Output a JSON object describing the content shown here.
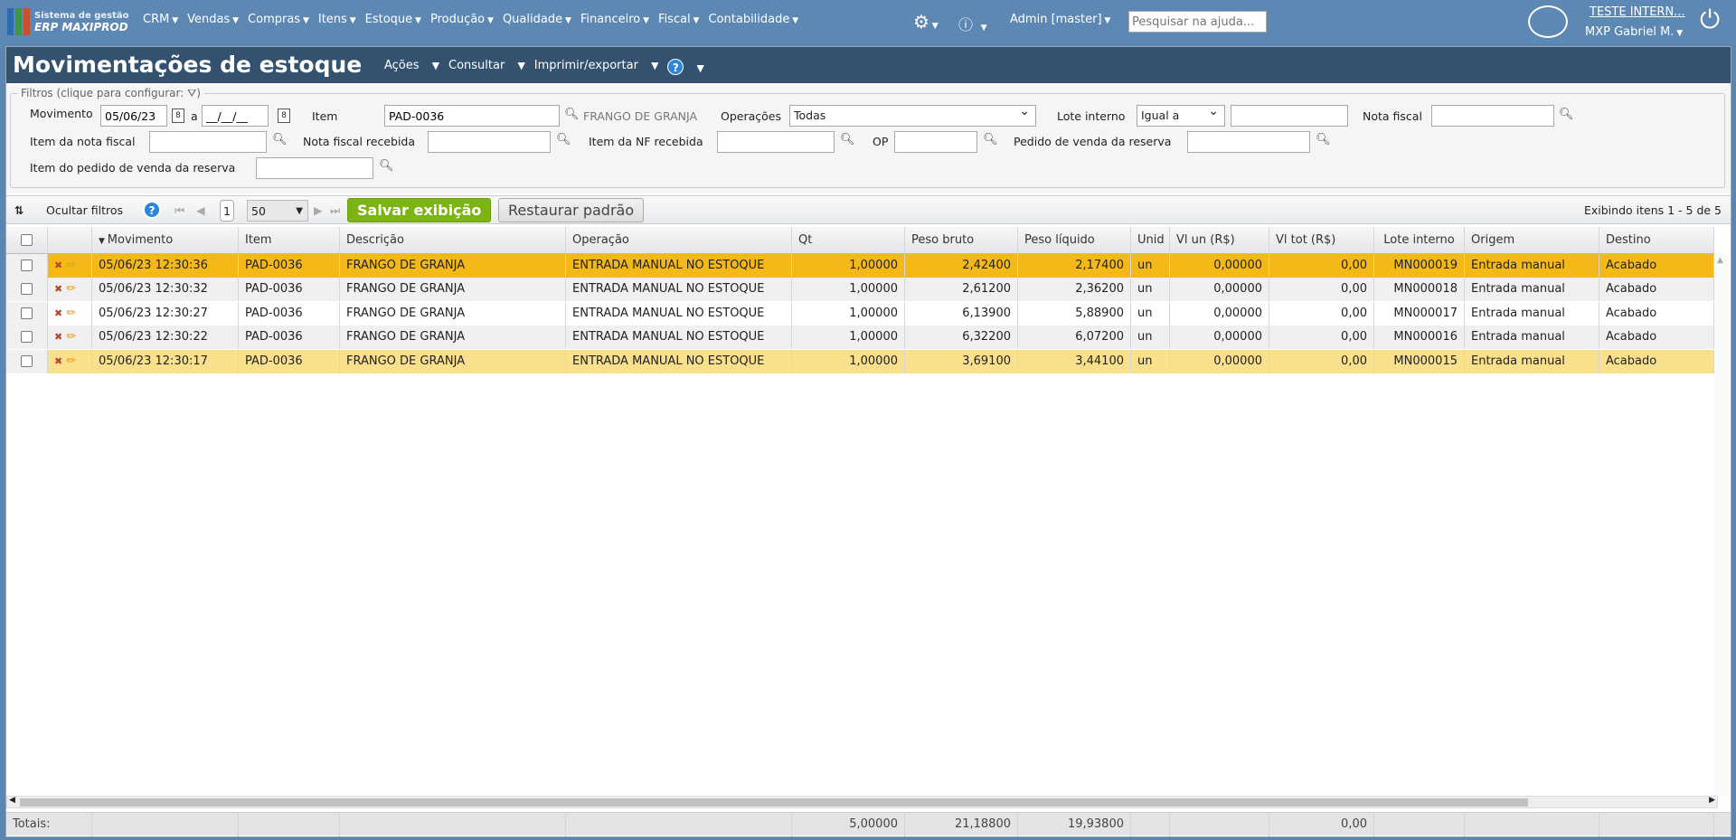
{
  "topbar": {
    "logo_line1": "Sistema de gestão",
    "logo_line2": "ERP MAXIPROD",
    "menu": [
      "CRM",
      "Vendas",
      "Compras",
      "Itens",
      "Estoque",
      "Produção",
      "Qualidade",
      "Financeiro",
      "Fiscal",
      "Contabilidade"
    ],
    "admin": "Admin [master]",
    "help_placeholder": "Pesquisar na ajuda...",
    "company": "TESTE INTERN...",
    "user": "MXP Gabriel M."
  },
  "page": {
    "title": "Movimentações de estoque",
    "menu": [
      "Ações",
      "Consultar",
      "Imprimir/exportar"
    ]
  },
  "filters": {
    "legend": "Filtros (clique para configurar:",
    "movimento_label": "Movimento",
    "movimento_from": "05/06/23",
    "a_label": "a",
    "movimento_to": "__/__/__",
    "item_label": "Item",
    "item_value": "PAD-0036",
    "item_desc": "FRANGO DE GRANJA",
    "operacoes_label": "Operações",
    "operacoes_value": "Todas",
    "lote_label": "Lote interno",
    "lote_op": "Igual a",
    "nota_label": "Nota fiscal",
    "item_nota_label": "Item da nota fiscal",
    "nf_recebida_label": "Nota fiscal recebida",
    "item_nf_recebida_label": "Item da NF recebida",
    "op_label": "OP",
    "pedido_label": "Pedido de venda da reserva",
    "item_pedido_label": "Item do pedido de venda da reserva"
  },
  "toolbar": {
    "hide_filters": "Ocultar filtros",
    "page": "1",
    "page_size": "50",
    "save": "Salvar exibição",
    "restore": "Restaurar padrão",
    "showing": "Exibindo itens 1 - 5 de 5"
  },
  "grid": {
    "columns": [
      "",
      "",
      "Movimento",
      "Item",
      "Descrição",
      "Operação",
      "Qt",
      "Peso bruto",
      "Peso líquido",
      "Unid",
      "Vl un (R$)",
      "Vl tot (R$)",
      "Lote interno",
      "Origem",
      "Destino"
    ],
    "rows": [
      [
        "05/06/23 12:30:36",
        "PAD-0036",
        "FRANGO DE GRANJA",
        "ENTRADA MANUAL NO ESTOQUE",
        "1,00000",
        "2,42400",
        "2,17400",
        "un",
        "0,00000",
        "0,00",
        "MN000019",
        "Entrada manual",
        "Acabado"
      ],
      [
        "05/06/23 12:30:32",
        "PAD-0036",
        "FRANGO DE GRANJA",
        "ENTRADA MANUAL NO ESTOQUE",
        "1,00000",
        "2,61200",
        "2,36200",
        "un",
        "0,00000",
        "0,00",
        "MN000018",
        "Entrada manual",
        "Acabado"
      ],
      [
        "05/06/23 12:30:27",
        "PAD-0036",
        "FRANGO DE GRANJA",
        "ENTRADA MANUAL NO ESTOQUE",
        "1,00000",
        "6,13900",
        "5,88900",
        "un",
        "0,00000",
        "0,00",
        "MN000017",
        "Entrada manual",
        "Acabado"
      ],
      [
        "05/06/23 12:30:22",
        "PAD-0036",
        "FRANGO DE GRANJA",
        "ENTRADA MANUAL NO ESTOQUE",
        "1,00000",
        "6,32200",
        "6,07200",
        "un",
        "0,00000",
        "0,00",
        "MN000016",
        "Entrada manual",
        "Acabado"
      ],
      [
        "05/06/23 12:30:17",
        "PAD-0036",
        "FRANGO DE GRANJA",
        "ENTRADA MANUAL NO ESTOQUE",
        "1,00000",
        "3,69100",
        "3,44100",
        "un",
        "0,00000",
        "0,00",
        "MN000015",
        "Entrada manual",
        "Acabado"
      ]
    ],
    "row_colors": [
      "#f4b916",
      "#f0f0f0",
      "#ffffff",
      "#f0f0f0",
      "#f9e08c"
    ],
    "totals": {
      "label": "Totais:",
      "qt": "5,00000",
      "peso_bruto": "21,18800",
      "peso_liquido": "19,93800",
      "vl_tot": "0,00"
    }
  },
  "colors": {
    "topbar": "#5d88b4",
    "titlebar": "#34516f",
    "save": "#7cb513"
  }
}
